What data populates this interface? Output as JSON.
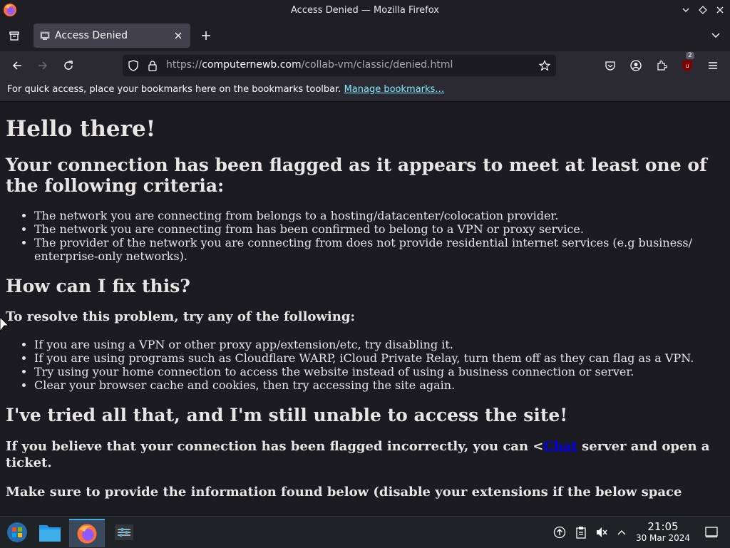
{
  "window": {
    "title": "Access Denied — Mozilla Firefox"
  },
  "tab": {
    "label": "Access Denied"
  },
  "navbar": {
    "url_prefix": "https://",
    "url_host": "computernewb.com",
    "url_path": "/collab-vm/classic/denied.html",
    "extension_badge": "2"
  },
  "bookmarks": {
    "message": "For quick access, place your bookmarks here on the bookmarks toolbar.",
    "manage_link": "Manage bookmarks…"
  },
  "page": {
    "heading": "Hello there!",
    "flagged_heading": "Your connection has been flagged as it appears to meet at least one of the following criteria:",
    "criteria": [
      "The network you are connecting from belongs to a hosting/datacenter/colocation provider.",
      "The network you are connecting from has been confirmed to belong to a VPN or proxy service.",
      "The provider of the network you are connecting from does not provide residential internet services (e.g business/ enterprise-only networks)."
    ],
    "fix_heading": "How can I fix this?",
    "resolve_heading": "To resolve this problem, try any of the following:",
    "fixes": [
      "If you are using a VPN or other proxy app/extension/etc, try disabling it.",
      "If you are using programs such as Cloudflare WARP, iCloud Private Relay, turn them off as they can flag as a VPN.",
      "Try using your home connection to access the website instead of using a business connection or server.",
      "Clear your browser cache and cookies, then try accessing the site again."
    ],
    "still_heading": "I've tried all that, and I'm still unable to access the site!",
    "incorrect_before": "If you believe that your connection has been flagged incorrectly, you can <",
    "chat_link": "Chat",
    "incorrect_after": " server and open a ticket.",
    "info_line": "Make sure to provide the information found below (disable your extensions if the below space"
  },
  "taskbar": {
    "time": "21:05",
    "date": "30 Mar 2024"
  },
  "colors": {
    "accent": "#3daee9",
    "link": "#0000ee",
    "bookmark_link": "#80ebff"
  }
}
